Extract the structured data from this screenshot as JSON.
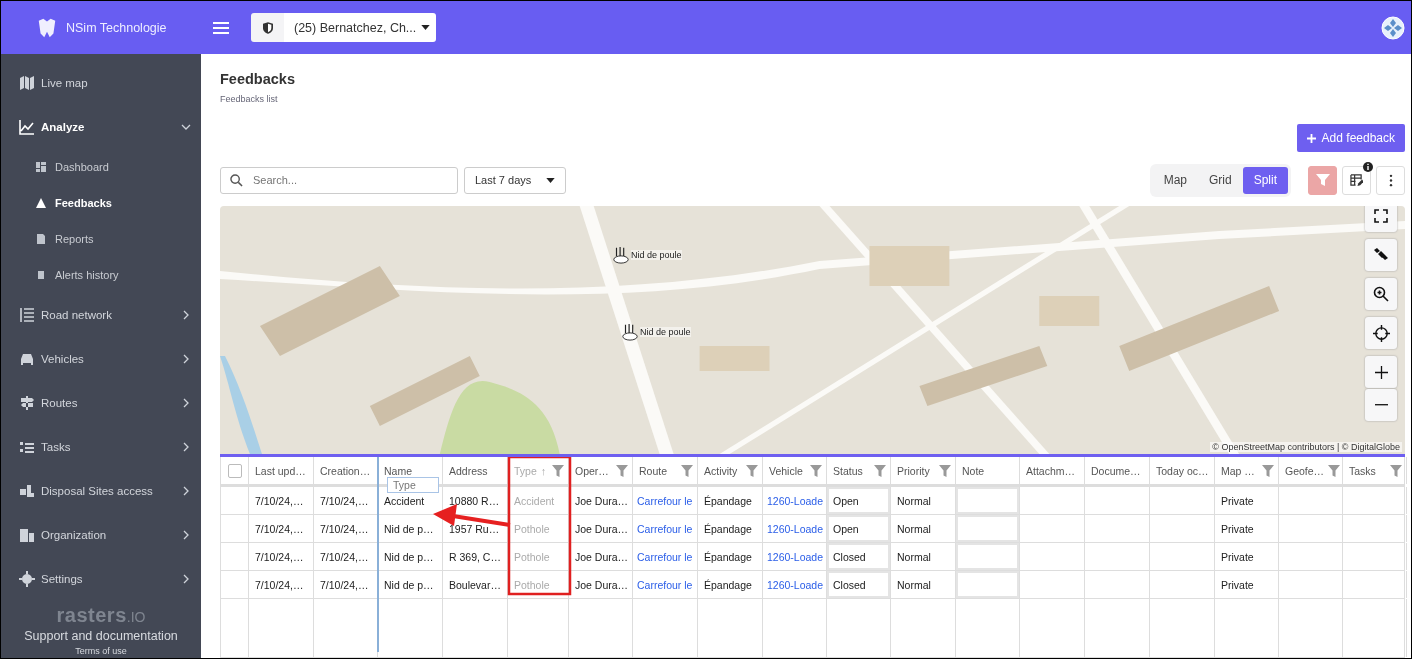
{
  "topbar": {
    "brand": "NSim Technologie",
    "account": "(25) Bernatchez, Ch..."
  },
  "sidebar": {
    "items": [
      {
        "label": "Live map",
        "expandable": false,
        "expanded": false
      },
      {
        "label": "Analyze",
        "expandable": true,
        "expanded": true,
        "children": [
          {
            "label": "Dashboard",
            "selected": false
          },
          {
            "label": "Feedbacks",
            "selected": true
          },
          {
            "label": "Reports",
            "selected": false
          },
          {
            "label": "Alerts history",
            "selected": false
          }
        ]
      },
      {
        "label": "Road network",
        "expandable": true,
        "expanded": false
      },
      {
        "label": "Vehicles",
        "expandable": true,
        "expanded": false
      },
      {
        "label": "Routes",
        "expandable": true,
        "expanded": false
      },
      {
        "label": "Tasks",
        "expandable": true,
        "expanded": false
      },
      {
        "label": "Disposal Sites access",
        "expandable": true,
        "expanded": false
      },
      {
        "label": "Organization",
        "expandable": true,
        "expanded": false
      },
      {
        "label": "Settings",
        "expandable": true,
        "expanded": false
      }
    ],
    "footer": {
      "logo_main": "rasters",
      "logo_suffix": ".IO",
      "support": "Support and documentation",
      "terms": "Terms of use"
    }
  },
  "page": {
    "title": "Feedbacks",
    "subtitle": "Feedbacks list",
    "add_button": "Add feedback"
  },
  "toolbar": {
    "search": {
      "placeholder": "Search..."
    },
    "period": "Last 7 days",
    "views": [
      {
        "label": "Map",
        "selected": false
      },
      {
        "label": "Grid",
        "selected": false
      },
      {
        "label": "Split",
        "selected": true
      }
    ],
    "filter_active": true
  },
  "map": {
    "kind": "picture",
    "markers": [
      {
        "label": "Nid de poule"
      },
      {
        "label": "Nid de poule"
      }
    ],
    "attribution": "© OpenStreetMap contributors | © DigitalGlobe"
  },
  "grid": {
    "select_all_checked": false,
    "columns": [
      {
        "label": "Last upd…",
        "filter": false,
        "kind": "text",
        "dragging": false
      },
      {
        "label": "Creation…",
        "filter": false,
        "kind": "text",
        "dragging": false
      },
      {
        "label": "Name",
        "filter": false,
        "kind": "text",
        "dragging": false
      },
      {
        "label": "Address",
        "filter": false,
        "kind": "text",
        "dragging": false
      },
      {
        "label": "Type",
        "filter": true,
        "kind": "text",
        "dragging": true,
        "sort_arrow": "↑"
      },
      {
        "label": "Oper…",
        "filter": true,
        "kind": "text",
        "dragging": false
      },
      {
        "label": "Route",
        "filter": true,
        "kind": "link",
        "dragging": false
      },
      {
        "label": "Activity",
        "filter": true,
        "kind": "text",
        "dragging": false
      },
      {
        "label": "Vehicle",
        "filter": true,
        "kind": "link",
        "dragging": false
      },
      {
        "label": "Status",
        "filter": true,
        "kind": "editable",
        "dragging": false
      },
      {
        "label": "Priority",
        "filter": true,
        "kind": "text",
        "dragging": false
      },
      {
        "label": "Note",
        "filter": false,
        "kind": "editable",
        "dragging": false
      },
      {
        "label": "Attachm…",
        "filter": false,
        "kind": "text",
        "dragging": false
      },
      {
        "label": "Docume…",
        "filter": false,
        "kind": "text",
        "dragging": false
      },
      {
        "label": "Today oc…",
        "filter": false,
        "kind": "text",
        "dragging": false
      },
      {
        "label": "Map …",
        "filter": true,
        "kind": "text",
        "dragging": false
      },
      {
        "label": "Geofe…",
        "filter": true,
        "kind": "text",
        "dragging": false
      },
      {
        "label": "Tasks",
        "filter": true,
        "kind": "text",
        "dragging": false
      }
    ],
    "rows": [
      {
        "cells": [
          "7/10/24,…",
          "7/10/24,…",
          "Accident",
          "10880 R…",
          "Accident",
          "Joe Dura…",
          "Carrefour le",
          "Épandage",
          "1260-Loade",
          "Open",
          "Normal",
          null,
          null,
          null,
          null,
          "Private",
          null,
          null
        ]
      },
      {
        "cells": [
          "7/10/24,…",
          "7/10/24,…",
          "Nid de p…",
          "1957 Ru…",
          "Pothole",
          "Joe Dura…",
          "Carrefour le",
          "Épandage",
          "1260-Loade",
          "Open",
          "Normal",
          null,
          null,
          null,
          null,
          "Private",
          null,
          null
        ]
      },
      {
        "cells": [
          "7/10/24,…",
          "7/10/24,…",
          "Nid de p…",
          "R 369, C…",
          "Pothole",
          "Joe Dura…",
          "Carrefour le",
          "Épandage",
          "1260-Loade",
          "Closed",
          "Normal",
          null,
          null,
          null,
          null,
          "Private",
          null,
          null
        ]
      },
      {
        "cells": [
          "7/10/24,…",
          "7/10/24,…",
          "Nid de p…",
          "Boulevar…",
          "Pothole",
          "Joe Dura…",
          "Carrefour le",
          "Épandage",
          "1260-Loade",
          "Closed",
          "Normal",
          null,
          null,
          null,
          null,
          "Private",
          null,
          null
        ]
      }
    ],
    "drag_ghost": "Type"
  }
}
